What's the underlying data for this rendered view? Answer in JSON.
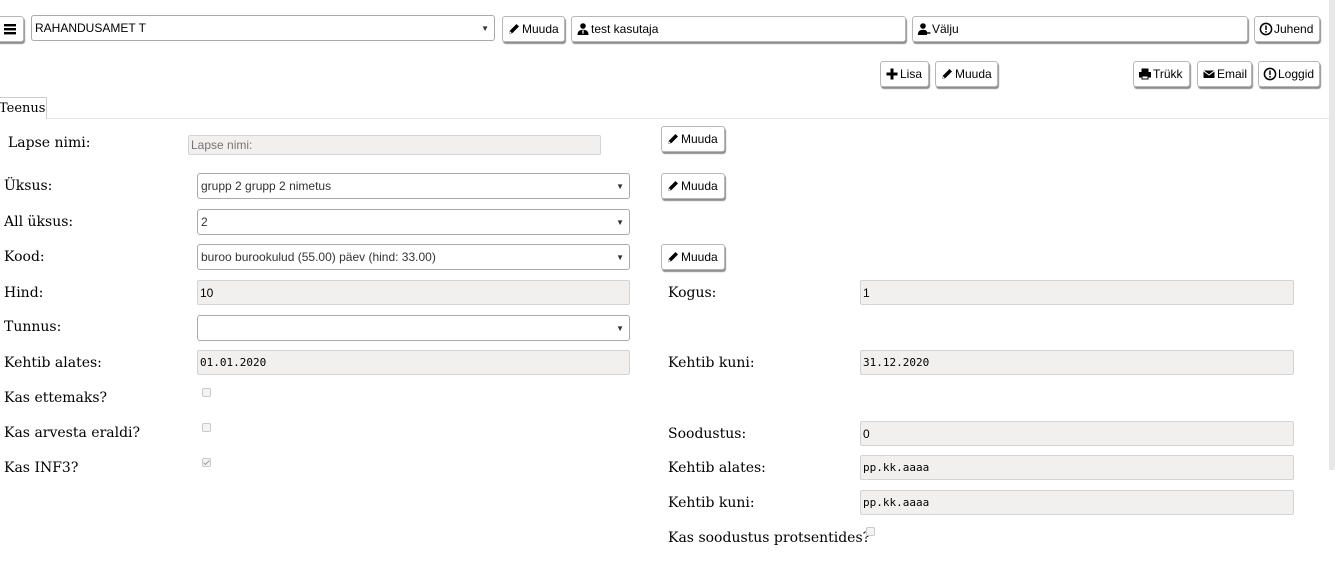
{
  "topbar": {
    "org_select_value": "RAHANDUSAMET T",
    "org_edit_label": "Muuda",
    "user_label": "test kasutaja",
    "logout_label": "Välju",
    "help_label": "Juhend"
  },
  "toolbar": {
    "add_label": "Lisa",
    "edit_label": "Muuda",
    "print_label": "Trükk",
    "email_label": "Email",
    "logs_label": "Loggid"
  },
  "tabs": {
    "service_tab": "Teenus"
  },
  "form": {
    "child_name_label": "Lapse nimi:",
    "child_name_placeholder": "Lapse nimi:",
    "child_name_edit": "Muuda",
    "unit_label": "Üksus:",
    "unit_value": "grupp 2 grupp 2 nimetus",
    "unit_edit": "Muuda",
    "subunit_label": "All üksus:",
    "subunit_value": "2",
    "code_label": "Kood:",
    "code_value": "buroo burookulud (55.00) päev (hind: 33.00)",
    "code_edit": "Muuda",
    "price_label": "Hind:",
    "price_value": "10",
    "quantity_label": "Kogus:",
    "quantity_value": "1",
    "tunnus_label": "Tunnus:",
    "tunnus_value": "",
    "valid_from_label": "Kehtib alates:",
    "valid_from_value": "01.01.2020",
    "valid_to_label": "Kehtib kuni:",
    "valid_to_value": "31.12.2020",
    "prepayment_label": "Kas ettemaks?",
    "prepayment_checked": false,
    "separate_label": "Kas arvesta eraldi?",
    "separate_checked": false,
    "inf3_label": "Kas INF3?",
    "inf3_checked": true,
    "discount_label": "Soodustus:",
    "discount_value": "0",
    "discount_from_label": "Kehtib alates:",
    "discount_from_value": "pp.kk.aaaa",
    "discount_to_label": "Kehtib kuni:",
    "discount_to_value": "pp.kk.aaaa",
    "discount_percent_label": "Kas soodustus protsentides?",
    "discount_percent_checked": false
  }
}
